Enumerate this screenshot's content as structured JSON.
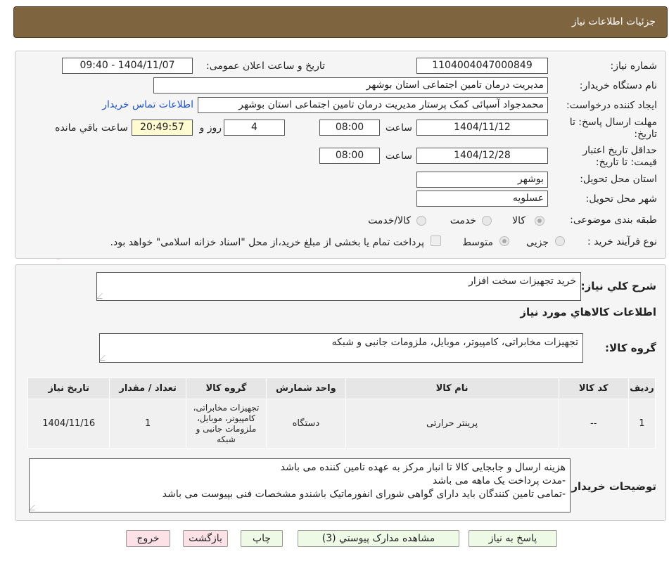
{
  "header": {
    "title": "جزئیات اطلاعات نیاز"
  },
  "watermark": "AriaTender.neT",
  "form": {
    "need_number_label": "شماره نیاز:",
    "need_number": "1104004047000849",
    "announce_label": "تاریخ و ساعت اعلان عمومی:",
    "announce_value": "1404/11/07 - 09:40",
    "buyer_org_label": "نام دستگاه خریدار:",
    "buyer_org": "مدیریت درمان تامین اجتماعی استان بوشهر",
    "creator_label": "ایجاد کننده درخواست:",
    "creator": "محمدجواد آسپائی کمک پرستار مدیریت درمان تامین اجتماعی استان بوشهر",
    "contact_link": "اطلاعات تماس خریدار",
    "deadline_label": "مهلت ارسال پاسخ: تا تاریخ:",
    "deadline_date": "1404/11/12",
    "time_label": "ساعت",
    "deadline_time": "08:00",
    "days_value": "4",
    "days_label": "روز و",
    "remaining_time": "20:49:57",
    "remaining_label": "ساعت باقي مانده",
    "validity_label": "حداقل تاریخ اعتبار قیمت: تا تاریخ:",
    "validity_date": "1404/12/28",
    "validity_time": "08:00",
    "province_label": "استان محل تحویل:",
    "province": "بوشهر",
    "city_label": "شهر محل تحویل:",
    "city": "عسلویه",
    "category_label": "طبقه بندی موضوعی:",
    "category_options": [
      "کالا",
      "خدمت",
      "کالا/خدمت"
    ],
    "process_label": "نوع فرآیند خرید :",
    "process_options": [
      "جزیی",
      "متوسط"
    ],
    "payment_note": "پرداخت تمام یا بخشی از مبلغ خرید،از محل \"اسناد خزانه اسلامی\" خواهد بود."
  },
  "summary": {
    "label": "شرح کلي نياز:",
    "value": "خرید تجهیزات سخت افزار",
    "goods_title": "اطلاعات کالاهاي مورد نياز",
    "group_label": "گروه کالا:",
    "group_value": "تجهیزات مخابراتی، کامپیوتر، موبایل، ملزومات جانبی و شبکه"
  },
  "table": {
    "headers": [
      "رديف",
      "کد کالا",
      "نام کالا",
      "واحد شمارش",
      "گروه کالا",
      "تعداد / مقدار",
      "تاریخ نیاز"
    ],
    "rows": [
      [
        "1",
        "--",
        "پرینتر حرارتی",
        "دستگاه",
        "تجهیزات مخابراتی، کامپیوتر، موبایل، ملزومات جانبی و شبکه",
        "1",
        "1404/11/16"
      ]
    ]
  },
  "buyer_notes": {
    "label": "توضیحات خریدار:",
    "lines": [
      "هزینه ارسال و جابجایی کالا تا انبار مرکز به عهده تامین کننده می باشد",
      "-مدت پرداخت یک ماهه می باشد",
      "-تمامی تامین کنندگان باید دارای گواهی شورای انفورماتیک باشندو مشخصات فنی بپیوست می باشد"
    ]
  },
  "buttons": {
    "reply": "پاسخ به نياز",
    "attachments": "مشاهده مدارک پيوستي (3)",
    "print": "چاپ",
    "back": "بازگشت",
    "exit": "خروج"
  },
  "colors": {
    "header_bg": "#7f6440",
    "link": "#2255cc",
    "green_button": "#eefae6",
    "pink_button": "#fce2e6"
  }
}
